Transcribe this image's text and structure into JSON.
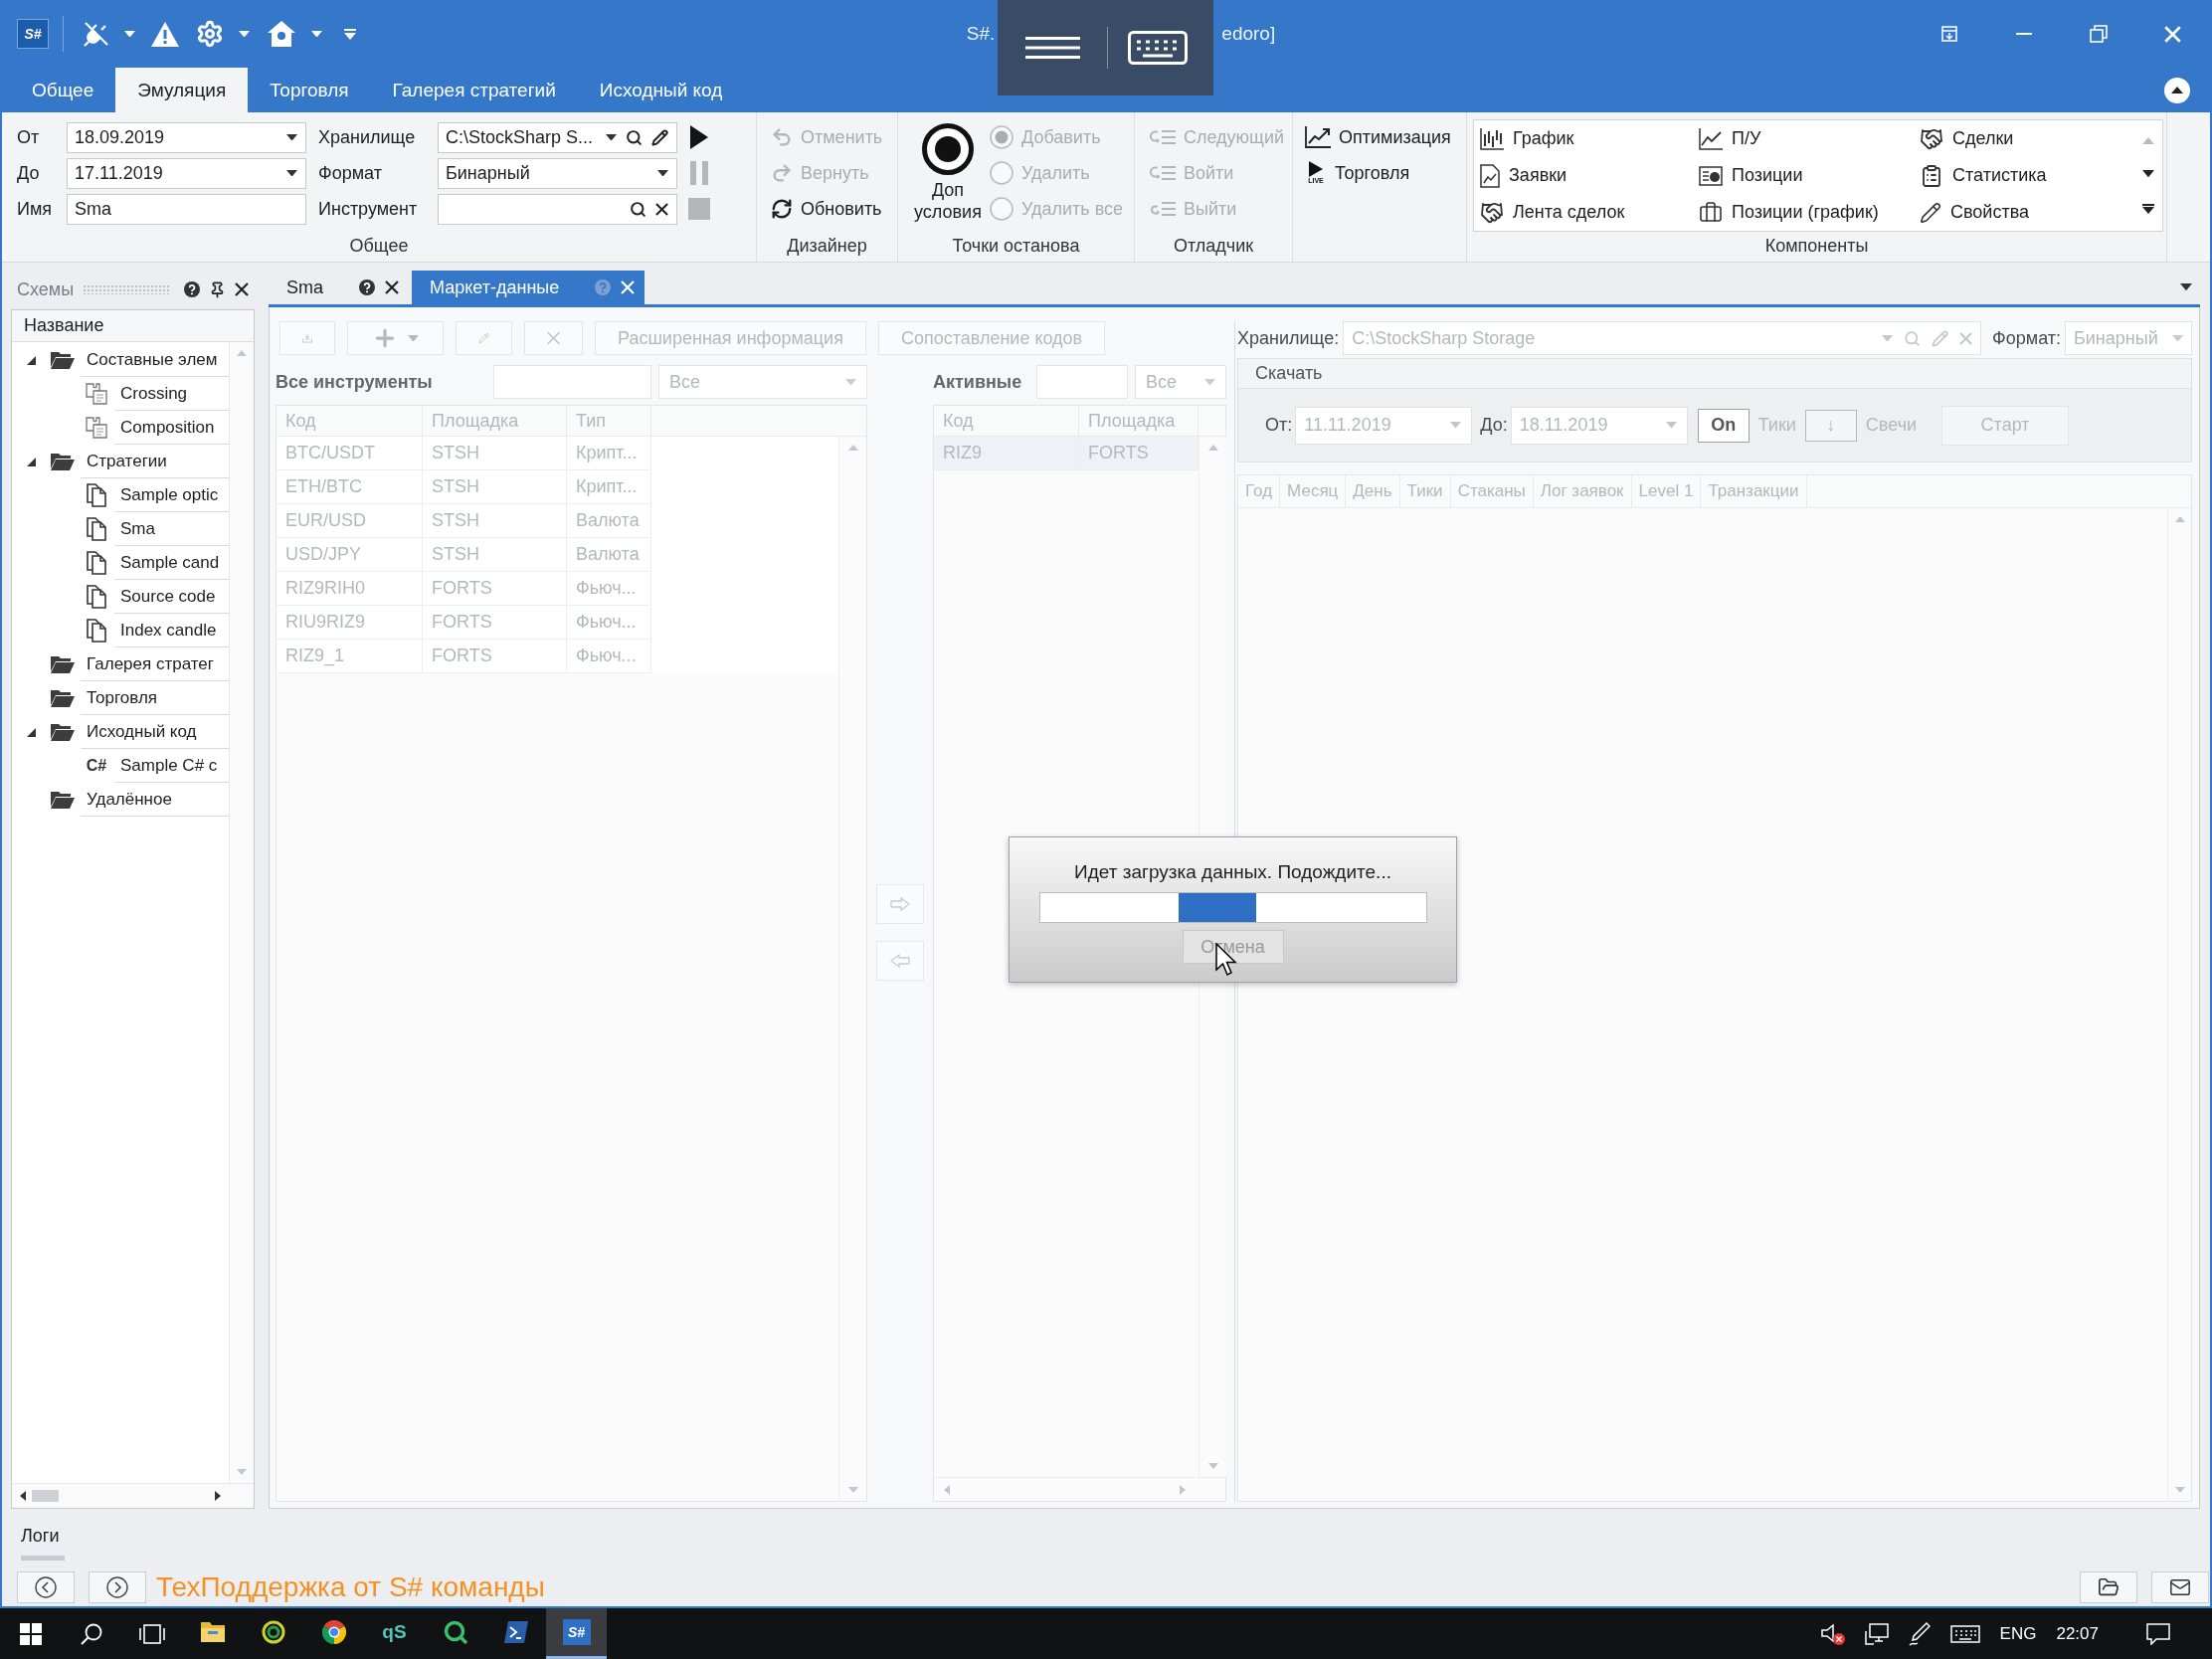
{
  "window": {
    "app_logo": "S#",
    "title_start": "S#.",
    "title_end": "edoro]"
  },
  "ribbon_tabs": [
    {
      "label": "Общее",
      "selected": false
    },
    {
      "label": "Эмуляция",
      "selected": true
    },
    {
      "label": "Торговля",
      "selected": false
    },
    {
      "label": "Галерея стратегий",
      "selected": false
    },
    {
      "label": "Исходный код",
      "selected": false
    }
  ],
  "general_group": {
    "title": "Общее",
    "fields": [
      {
        "label": "От",
        "value": "18.09.2019",
        "kind": "combo"
      },
      {
        "label": "До",
        "value": "17.11.2019",
        "kind": "combo"
      },
      {
        "label": "Имя",
        "value": "Sma",
        "kind": "text"
      },
      {
        "label": "Хранилище",
        "value": "C:\\StockSharp S...",
        "kind": "path"
      },
      {
        "label": "Формат",
        "value": "Бинарный",
        "kind": "combo"
      },
      {
        "label": "Инструмент",
        "kind": "search"
      }
    ],
    "run_buttons": [
      {
        "kind": "play",
        "disabled": false
      },
      {
        "kind": "pause",
        "disabled": true
      },
      {
        "kind": "stop",
        "disabled": true
      }
    ]
  },
  "designer_group": {
    "title": "Дизайнер",
    "buttons": [
      {
        "kind": "undo",
        "label": "Отменить",
        "disabled": true
      },
      {
        "kind": "redo",
        "label": "Вернуть",
        "disabled": true
      },
      {
        "kind": "refresh",
        "label": "Обновить",
        "disabled": false
      }
    ]
  },
  "breakpoints_group": {
    "title": "Точки останова",
    "conditions_button": "Доп условия",
    "options": [
      {
        "label": "Добавить",
        "selected": true,
        "disabled": true
      },
      {
        "label": "Удалить",
        "selected": false,
        "disabled": true
      },
      {
        "label": "Удалить все",
        "selected": false,
        "disabled": true
      }
    ]
  },
  "debugger_group": {
    "title": "Отладчик",
    "buttons": [
      {
        "kind": "step_next",
        "label": "Следующий",
        "disabled": true
      },
      {
        "kind": "step_in",
        "label": "Войти",
        "disabled": true
      },
      {
        "kind": "step_out",
        "label": "Выйти",
        "disabled": true
      }
    ]
  },
  "mode_group": {
    "buttons": [
      {
        "kind": "optimization",
        "label": "Оптимизация"
      },
      {
        "kind": "live",
        "label": "Торговля",
        "badge": "LIVE"
      }
    ]
  },
  "components_group": {
    "title": "Компоненты",
    "items": [
      {
        "kind": "chart",
        "label": "График"
      },
      {
        "kind": "pnl",
        "label": "П/У"
      },
      {
        "kind": "trades",
        "label": "Сделки"
      },
      {
        "kind": "orders",
        "label": "Заявки"
      },
      {
        "kind": "positions",
        "label": "Позиции"
      },
      {
        "kind": "statistics",
        "label": "Статистика"
      },
      {
        "kind": "tape",
        "label": "Лента сделок"
      },
      {
        "kind": "positions_chart",
        "label": "Позиции (график)"
      },
      {
        "kind": "properties",
        "label": "Свойства"
      }
    ]
  },
  "schemes_panel": {
    "title": "Схемы",
    "column": "Название",
    "tree": [
      {
        "label": "Составные элем",
        "kind": "folder",
        "expanded": true,
        "children": [
          {
            "label": "Crossing",
            "kind": "composite"
          },
          {
            "label": "Composition",
            "kind": "composite"
          }
        ]
      },
      {
        "label": "Стратегии",
        "kind": "folder",
        "expanded": true,
        "children": [
          {
            "label": "Sample optic",
            "kind": "document"
          },
          {
            "label": "Sma",
            "kind": "document"
          },
          {
            "label": "Sample cand",
            "kind": "document"
          },
          {
            "label": "Source code",
            "kind": "document"
          },
          {
            "label": "Index candle",
            "kind": "document"
          }
        ]
      },
      {
        "label": "Галерея стратег",
        "kind": "folder"
      },
      {
        "label": "Торговля",
        "kind": "folder"
      },
      {
        "label": "Исходный код",
        "kind": "folder",
        "expanded": true,
        "children": [
          {
            "label": "Sample C# c",
            "kind": "csharp",
            "badge": "C#"
          }
        ]
      },
      {
        "label": "Удалённое",
        "kind": "folder"
      }
    ]
  },
  "document_tabs": [
    {
      "label": "Sma",
      "selected": false
    },
    {
      "label": "Маркет-данные",
      "selected": true
    }
  ],
  "market_data": {
    "disabled": true,
    "toolbar": [
      {
        "kind": "import"
      },
      {
        "kind": "add"
      },
      {
        "kind": "edit"
      },
      {
        "kind": "delete"
      },
      {
        "kind": "text",
        "label": "Расширенная информация"
      },
      {
        "kind": "text",
        "label": "Сопоставление кодов"
      }
    ],
    "all_instruments": {
      "title": "Все инструменты",
      "type_filter": "Все",
      "columns": [
        "Код",
        "Площадка",
        "Тип"
      ],
      "rows": [
        {
          "cells": [
            "BTC/USDT",
            "STSH",
            "Крипт..."
          ],
          "selected": false
        },
        {
          "cells": [
            "ETH/BTC",
            "STSH",
            "Крипт..."
          ],
          "selected": false
        },
        {
          "cells": [
            "EUR/USD",
            "STSH",
            "Валюта"
          ],
          "selected": false
        },
        {
          "cells": [
            "USD/JPY",
            "STSH",
            "Валюта"
          ],
          "selected": false
        },
        {
          "cells": [
            "RIZ9RIH0",
            "FORTS",
            "Фьюч..."
          ],
          "selected": false
        },
        {
          "cells": [
            "RIU9RIZ9",
            "FORTS",
            "Фьюч..."
          ],
          "selected": false
        },
        {
          "cells": [
            "RIZ9_1",
            "FORTS",
            "Фьюч..."
          ],
          "selected": false
        }
      ]
    },
    "active": {
      "title": "Активные",
      "type_filter": "Все",
      "columns": [
        "Код",
        "Площадка"
      ],
      "rows": [
        {
          "cells": [
            "RIZ9",
            "FORTS"
          ],
          "selected": true
        }
      ]
    },
    "storage": {
      "label": "Хранилище:",
      "value": "C:\\StockSharp Storage"
    },
    "format": {
      "label": "Формат:",
      "value": "Бинарный"
    },
    "download": {
      "title": "Скачать",
      "from": {
        "label": "От:",
        "value": "11.11.2019"
      },
      "to": {
        "label": "До:",
        "value": "18.11.2019"
      },
      "on_button": "On",
      "ticks_label": "Тики",
      "arrow_button": "↓",
      "candles_label": "Свечи",
      "start_button": "Старт"
    },
    "data_columns": [
      "Год",
      "Месяц",
      "День",
      "Тики",
      "Стаканы",
      "Лог заявок",
      "Level 1",
      "Транзакции"
    ]
  },
  "loading_dialog": {
    "message": "Идет загрузка данных. Подождите...",
    "indeterminate": true,
    "cancel_button": {
      "label": "Отмена",
      "disabled": true
    }
  },
  "logs": {
    "title": "Логи"
  },
  "status_bar": {
    "support_link": "ТехПоддержка от S# команды"
  },
  "taskbar": {
    "apps": [
      {
        "kind": "explorer",
        "selected": false
      },
      {
        "kind": "swirl",
        "selected": false
      },
      {
        "kind": "chrome",
        "selected": false
      },
      {
        "kind": "qs",
        "label": "qS",
        "selected": false
      },
      {
        "kind": "ring",
        "selected": false
      },
      {
        "kind": "powershell",
        "selected": false
      },
      {
        "kind": "s_sharp",
        "label": "S#",
        "selected": true
      }
    ],
    "language": "ENG",
    "time": "22:07"
  }
}
